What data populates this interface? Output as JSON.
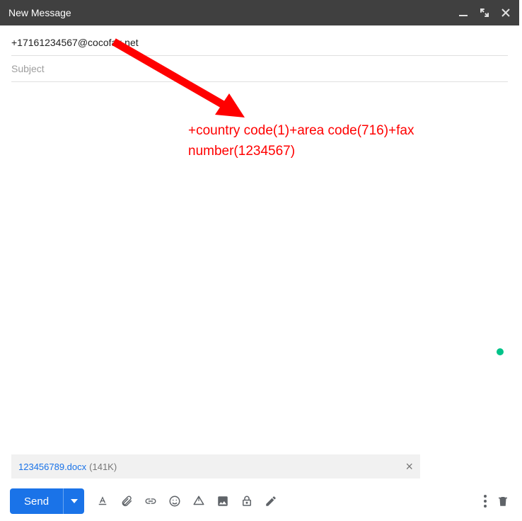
{
  "header": {
    "title": "New Message"
  },
  "fields": {
    "to": "+17161234567@cocofax.net",
    "subject_placeholder": "Subject"
  },
  "annotation": {
    "line1": "+country code(1)+area code(716)+fax",
    "line2": "number(1234567)"
  },
  "attachment": {
    "filename": "123456789.docx",
    "size": "(141K)"
  },
  "toolbar": {
    "send_label": "Send"
  },
  "icons": {
    "minimize": "minimize",
    "fullscreen": "fullscreen",
    "close": "close",
    "format": "format",
    "attach": "attach",
    "link": "link",
    "emoji": "emoji",
    "drive": "drive",
    "image": "image",
    "confidential": "confidential",
    "pen": "pen",
    "more": "more",
    "trash": "trash"
  }
}
